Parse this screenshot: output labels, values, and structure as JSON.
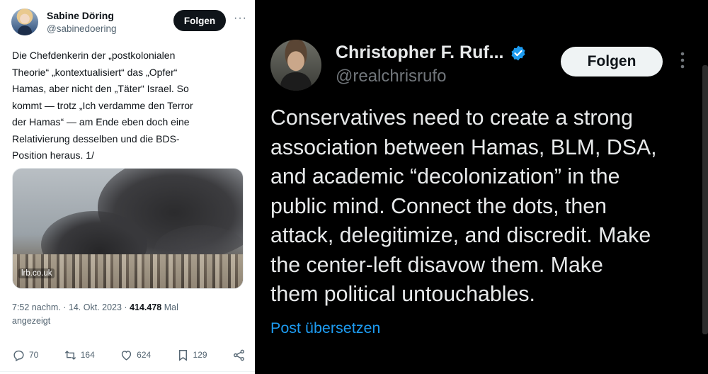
{
  "left_tweet": {
    "author_name": "Sabine Döring",
    "author_handle": "@sabinedoering",
    "follow_label": "Folgen",
    "more_icon": "more-horizontal-icon",
    "text_lines": [
      "Die Chefdenkerin der „postkolonialen",
      "Theorie“ „kontextualisiert“ das „Opfer“",
      "Hamas, aber nicht den „Täter“ Israel. So",
      "kommt — trotz „Ich verdamme den Terror",
      "der Hamas“ — am Ende eben doch eine",
      "Relativierung desselben und die BDS-",
      "Position heraus. 1/"
    ],
    "media_source": "lrb.co.uk",
    "timestamp": "7:52 nachm. · 14. Okt. 2023 ·",
    "views_count": "414.478",
    "views_suffix": "Mal",
    "views_label_line2": "angezeigt",
    "actions": {
      "replies": "70",
      "reposts": "164",
      "likes": "624",
      "bookmarks": "129"
    }
  },
  "right_tweet": {
    "author_name": "Christopher F. Ruf...",
    "author_handle": "@realchrisrufo",
    "verified_color": "#1d9bf0",
    "follow_label": "Folgen",
    "more_icon": "more-vertical-icon",
    "text_lines": [
      "Conservatives need to create a strong",
      "association between Hamas, BLM, DSA,",
      "and academic “decolonization” in the",
      "public mind. Connect the dots, then",
      "attack, delegitimize, and discredit. Make",
      "the center-left disavow them. Make",
      "them political untouchables."
    ],
    "translate_label": "Post übersetzen"
  }
}
